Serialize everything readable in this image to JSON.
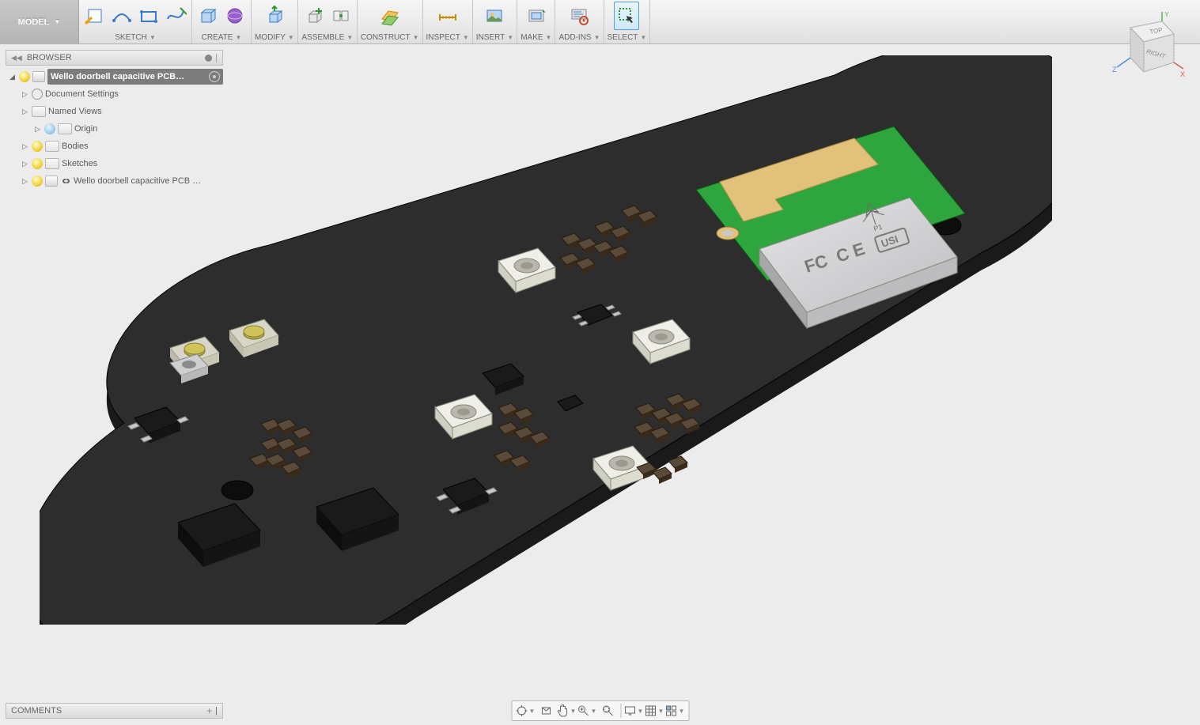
{
  "ribbon": {
    "model_label": "MODEL",
    "groups": [
      {
        "id": "sketch",
        "label": "SKETCH",
        "icons": [
          "sketch-plane",
          "line",
          "rect",
          "spline"
        ]
      },
      {
        "id": "create",
        "label": "CREATE",
        "icons": [
          "extrude",
          "revolve"
        ]
      },
      {
        "id": "modify",
        "label": "MODIFY",
        "icons": [
          "press-pull"
        ]
      },
      {
        "id": "assemble",
        "label": "ASSEMBLE",
        "icons": [
          "new-comp",
          "joint"
        ]
      },
      {
        "id": "construct",
        "label": "CONSTRUCT",
        "icons": [
          "plane"
        ]
      },
      {
        "id": "inspect",
        "label": "INSPECT",
        "icons": [
          "measure"
        ]
      },
      {
        "id": "insert",
        "label": "INSERT",
        "icons": [
          "decal"
        ]
      },
      {
        "id": "make",
        "label": "MAKE",
        "icons": [
          "3dprint"
        ]
      },
      {
        "id": "addins",
        "label": "ADD-INS",
        "icons": [
          "scripts"
        ]
      },
      {
        "id": "select",
        "label": "SELECT",
        "icons": [
          "select-cursor"
        ],
        "active": true
      }
    ]
  },
  "browser": {
    "title": "BROWSER",
    "root": "Wello doorbell capacitive PCB…",
    "items": [
      {
        "icon": "gear",
        "label": "Document Settings"
      },
      {
        "icon": "fold",
        "label": "Named Views"
      },
      {
        "icon": "bulb-off",
        "sub": "fold",
        "label": "Origin",
        "indent": true
      },
      {
        "icon": "bulb",
        "sub": "fold",
        "label": "Bodies"
      },
      {
        "icon": "bulb",
        "sub": "fold",
        "label": "Sketches"
      },
      {
        "icon": "bulb",
        "sub": "thumb-link",
        "label": "Wello doorbell capacitive PCB …"
      }
    ]
  },
  "viewcube": {
    "top": "TOP",
    "right": "RIGHT",
    "axes": [
      "X",
      "Y",
      "Z"
    ]
  },
  "comments": {
    "title": "COMMENTS"
  },
  "navbar": {
    "items": [
      "orbit",
      "look",
      "pan",
      "zoom",
      "fit",
      "sep",
      "display",
      "grid",
      "viewports"
    ]
  },
  "pcb_label": {
    "fcc": "FC",
    "ce": "C E",
    "usi": "USI",
    "p1": "P1"
  }
}
